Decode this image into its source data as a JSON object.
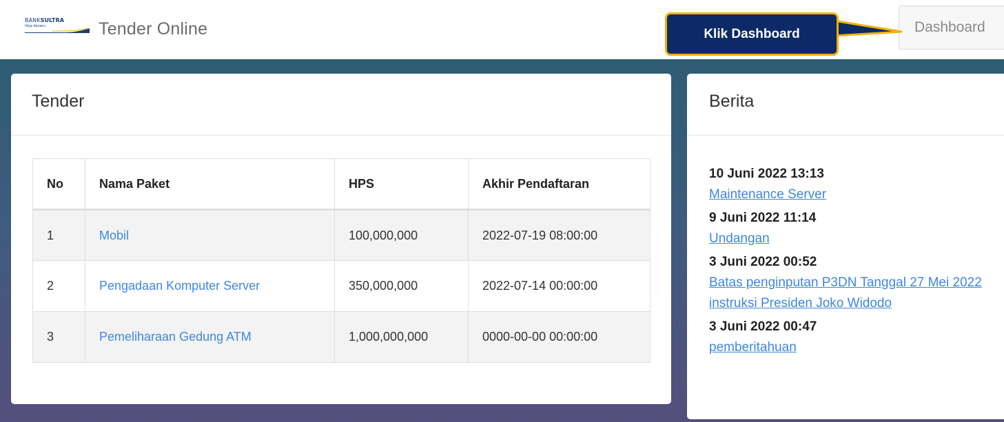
{
  "header": {
    "logo_brand_prefix": "BANK",
    "logo_brand_name": "SULTRA",
    "logo_tagline": "hbja denaru",
    "app_title": "Tender Online",
    "dashboard_button": "Dashboard"
  },
  "callout": {
    "text": "Klik Dashboard",
    "colors": {
      "fill": "#0b2a66",
      "border": "#f2b100"
    }
  },
  "tender_card": {
    "title": "Tender",
    "columns": [
      "No",
      "Nama Paket",
      "HPS",
      "Akhir Pendaftaran"
    ],
    "rows": [
      {
        "no": "1",
        "nama_paket": "Mobil",
        "hps": "100,000,000",
        "akhir": "2022-07-19 08:00:00"
      },
      {
        "no": "2",
        "nama_paket": "Pengadaan Komputer Server",
        "hps": "350,000,000",
        "akhir": "2022-07-14 00:00:00"
      },
      {
        "no": "3",
        "nama_paket": "Pemeliharaan Gedung ATM",
        "hps": "1,000,000,000",
        "akhir": "0000-00-00 00:00:00"
      }
    ]
  },
  "berita_card": {
    "title": "Berita",
    "items": [
      {
        "date": "10 Juni 2022 13:13",
        "title": "Maintenance Server"
      },
      {
        "date": "9 Juni 2022 11:14",
        "title": "Undangan"
      },
      {
        "date": "3 Juni 2022 00:52",
        "title": "Batas penginputan P3DN Tanggal 27 Mei 2022 instruksi Presiden Joko Widodo"
      },
      {
        "date": "3 Juni 2022 00:47",
        "title": "pemberitahuan"
      }
    ]
  },
  "colors": {
    "link": "#3f86e0",
    "gradient_top": "#2e5d74",
    "gradient_bottom": "#544f7c"
  }
}
